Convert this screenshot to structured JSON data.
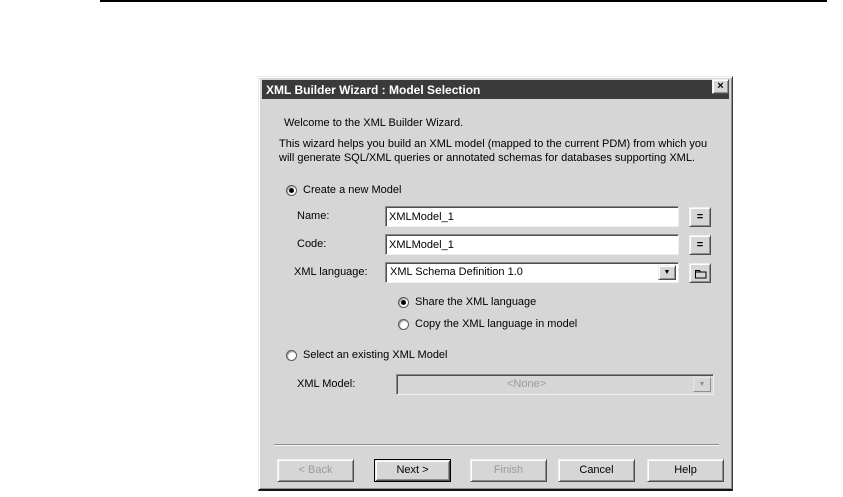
{
  "icons": {
    "close": "×",
    "dropdown_arrow": "▼"
  },
  "dialog": {
    "title": "XML Builder Wizard : Model Selection",
    "intro_line1": "Welcome to the XML Builder Wizard.",
    "intro_line2": "This wizard helps you build an XML model (mapped to the current PDM) from which you",
    "intro_line3": "will generate SQL/XML queries or annotated schemas for databases supporting XML.",
    "create": {
      "label": "Create a new Model",
      "name_label": "Name:",
      "name_value": "XMLModel_1",
      "name_button_label": "=",
      "code_label": "Code:",
      "code_value": "XMLModel_1",
      "code_button_label": "=",
      "language_label": "XML language:",
      "language_value": "XML Schema Definition 1.0",
      "share_label": "Share the XML language",
      "copy_label": "Copy the XML language in model"
    },
    "existing": {
      "label": "Select an existing XML Model",
      "model_label": "XML Model:",
      "model_value": "<None>"
    },
    "buttons": {
      "back": "< Back",
      "next": "Next >",
      "finish": "Finish",
      "cancel": "Cancel",
      "help": "Help"
    }
  }
}
